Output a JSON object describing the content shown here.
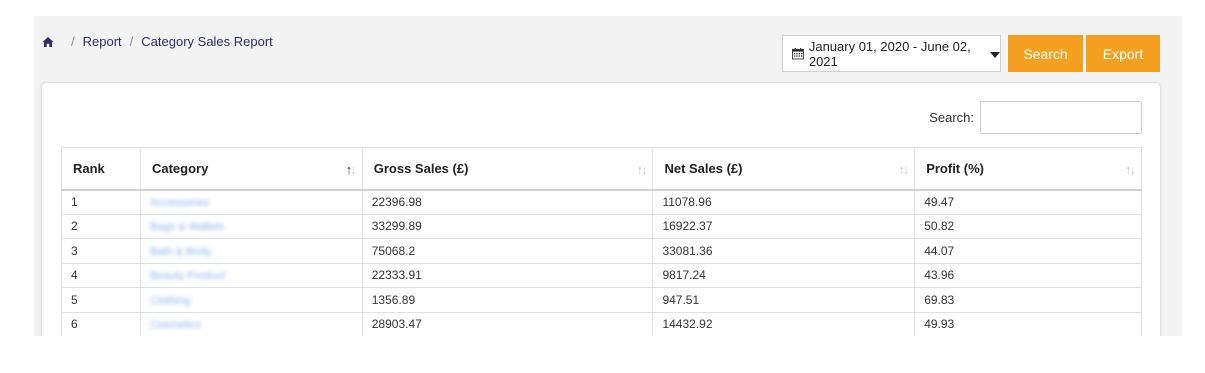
{
  "breadcrumb": {
    "home_icon": "home-icon",
    "items": [
      "Report",
      "Category Sales Report"
    ]
  },
  "date_range": {
    "icon": "calendar-icon",
    "value": "January 01, 2020 - June 02, 2021"
  },
  "actions": {
    "search_label": "Search",
    "export_label": "Export",
    "accent_color": "#f5a020"
  },
  "table_search": {
    "label": "Search:",
    "value": ""
  },
  "table": {
    "columns": [
      "Rank",
      "Category",
      "Gross Sales (£)",
      "Net Sales (£)",
      "Profit (%)"
    ],
    "sorted_column": "Category",
    "rows": [
      {
        "rank": "1",
        "category": "Accessories",
        "gross": "22396.98",
        "net": "11078.96",
        "profit": "49.47"
      },
      {
        "rank": "2",
        "category": "Bags & Wallets",
        "gross": "33299.89",
        "net": "16922.37",
        "profit": "50.82"
      },
      {
        "rank": "3",
        "category": "Bath & Body",
        "gross": "75068.2",
        "net": "33081.36",
        "profit": "44.07"
      },
      {
        "rank": "4",
        "category": "Beauty Product",
        "gross": "22333.91",
        "net": "9817.24",
        "profit": "43.96"
      },
      {
        "rank": "5",
        "category": "Clothing",
        "gross": "1356.89",
        "net": "947.51",
        "profit": "69.83"
      },
      {
        "rank": "6",
        "category": "Cosmetics",
        "gross": "28903.47",
        "net": "14432.92",
        "profit": "49.93"
      }
    ]
  }
}
